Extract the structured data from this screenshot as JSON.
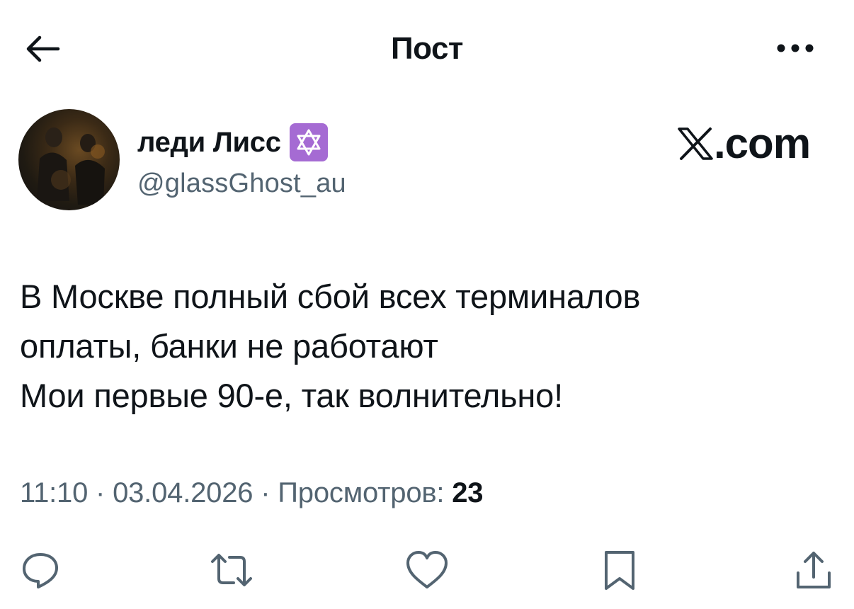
{
  "header": {
    "title": "Пост",
    "back_icon": "arrow-left-icon",
    "more_icon": "more-horizontal-icon"
  },
  "author": {
    "display_name": "леди Лисс",
    "badge_icon": "star-of-david-emoji",
    "handle": "@glassGhost_au"
  },
  "brand": {
    "text": ".com",
    "logo_icon": "x-logo-icon"
  },
  "tweet": {
    "lines": [
      "В Москве полный сбой всех терминалов",
      "оплаты, банки не работают",
      "Мои первые 90-е, так волнительно!"
    ]
  },
  "meta": {
    "time": "11:10",
    "separator": " · ",
    "date": "03.04.2026",
    "views_label": "Просмотров: ",
    "views_count": "23"
  },
  "actions": [
    {
      "icon": "reply-icon"
    },
    {
      "icon": "retweet-icon"
    },
    {
      "icon": "like-icon"
    },
    {
      "icon": "bookmark-icon"
    },
    {
      "icon": "share-icon"
    }
  ],
  "colors": {
    "text": "#0f1419",
    "secondary": "#536471",
    "badge": "#a56bd3"
  }
}
